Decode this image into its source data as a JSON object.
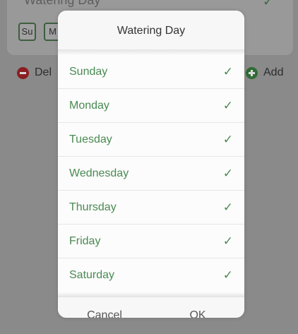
{
  "background": {
    "card_title": "Watering Day",
    "day_chips": [
      "Su",
      "M"
    ],
    "delete_label": "Del",
    "add_label": "Add"
  },
  "dialog": {
    "title": "Watering Day",
    "days": [
      {
        "label": "Sunday",
        "checked": true
      },
      {
        "label": "Monday",
        "checked": true
      },
      {
        "label": "Tuesday",
        "checked": true
      },
      {
        "label": "Wednesday",
        "checked": true
      },
      {
        "label": "Thursday",
        "checked": true
      },
      {
        "label": "Friday",
        "checked": true
      },
      {
        "label": "Saturday",
        "checked": true
      }
    ],
    "check_glyph": "✓",
    "cancel_label": "Cancel",
    "ok_label": "OK"
  },
  "colors": {
    "accent_green": "#4a8a52",
    "delete_red": "#8c1e22",
    "overlay_gray": "#8a8a8a"
  }
}
